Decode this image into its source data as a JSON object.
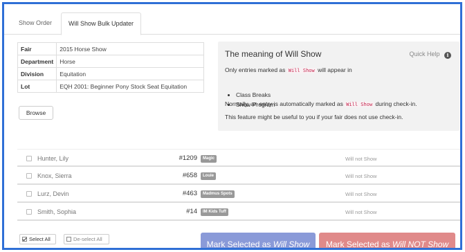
{
  "tabs": [
    {
      "label": "Show Order"
    },
    {
      "label": "Will Show Bulk Updater"
    }
  ],
  "info": [
    {
      "key": "Fair",
      "value": "2015 Horse Show"
    },
    {
      "key": "Department",
      "value": "Horse"
    },
    {
      "key": "Division",
      "value": "Equitation"
    },
    {
      "key": "Lot",
      "value": "EQH 2001: Beginner Pony Stock Seat Equitation"
    }
  ],
  "browse_label": "Browse",
  "help": {
    "title": "The meaning of Will Show",
    "quick_help": "Quick Help",
    "line1_pre": "Only entries marked as",
    "code": "Will Show",
    "line1_post": "will appear in",
    "bullets": [
      "Class Breaks",
      "Show Program"
    ],
    "line2_pre": "Normally, an entry is automatically marked as",
    "line2_post": "during check-in.",
    "line3": "This feature might be useful to you if your fair does not use check-in."
  },
  "entries": [
    {
      "name": "Hunter, Lily",
      "number": "#1209",
      "horse": "Magic",
      "status": "Will not Show"
    },
    {
      "name": "Knox, Sierra",
      "number": "#658",
      "horse": "Louie",
      "status": "Will not Show"
    },
    {
      "name": "Lurz, Devin",
      "number": "#463",
      "horse": "Madmus Spots",
      "status": "Will not Show"
    },
    {
      "name": "Smith, Sophia",
      "number": "#14",
      "horse": "IM Kids Tuff",
      "status": "Will not Show"
    }
  ],
  "select_all": "Select All",
  "deselect_all": "De-select All",
  "mark_show_pre": "Mark Selected as",
  "mark_show_em": "Will Show",
  "mark_noshow_pre": "Mark Selected as",
  "mark_noshow_em": "Will NOT Show",
  "colors": {
    "frame": "#2f6fd6",
    "show_button": "#8a9ad8",
    "noshow_button": "#e08a8a",
    "code": "#c7254e"
  }
}
